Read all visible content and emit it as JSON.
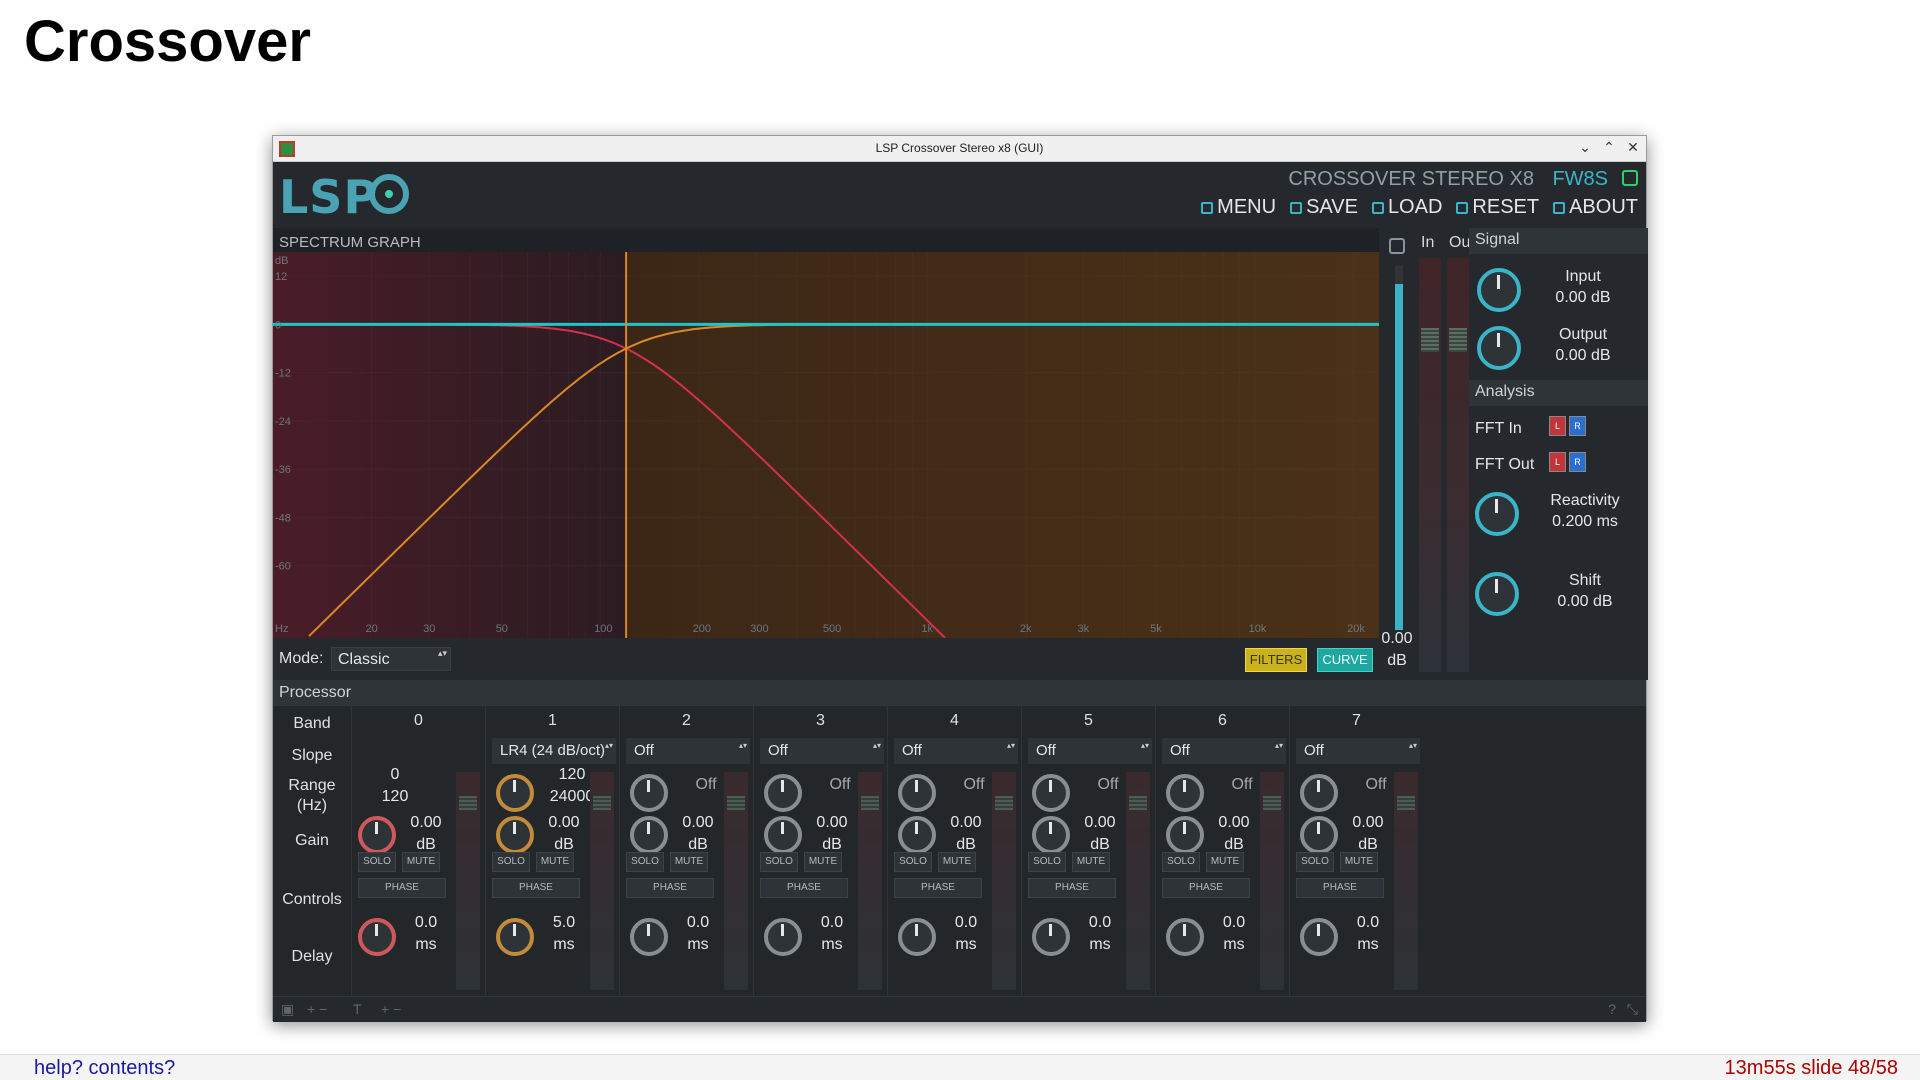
{
  "slide": {
    "title": "Crossover",
    "help": "help? contents?",
    "info": "13m55s slide 48/58"
  },
  "window": {
    "title": "LSP Crossover Stereo x8 (GUI)",
    "controls": [
      "⌄",
      "⌃",
      "✕"
    ]
  },
  "header": {
    "logo": "LSP",
    "plugin_name": "CROSSOVER STEREO X8",
    "format": "FW8S",
    "menu": [
      {
        "label": "MENU",
        "icon": "menu-icon"
      },
      {
        "label": "SAVE",
        "icon": "save-icon"
      },
      {
        "label": "LOAD",
        "icon": "load-icon"
      },
      {
        "label": "RESET",
        "icon": "reset-icon"
      },
      {
        "label": "ABOUT",
        "icon": "about-icon"
      }
    ]
  },
  "graph": {
    "label": "SPECTRUM GRAPH",
    "y_unit": "dB",
    "y_ticks": [
      "12",
      "0",
      "-12",
      "-24",
      "-36",
      "-48",
      "-60"
    ],
    "x_unit": "Hz",
    "x_ticks": [
      "20",
      "30",
      "50",
      "100",
      "200",
      "300",
      "500",
      "1k",
      "2k",
      "3k",
      "5k",
      "10k",
      "20k"
    ],
    "crossover_hz": 120,
    "colors": {
      "flat": "#22c3c8",
      "lowpass": "#d4304a",
      "highpass": "#d98a22"
    }
  },
  "mode": {
    "label": "Mode:",
    "value": "Classic",
    "filters": "FILTERS",
    "curve": "CURVE"
  },
  "meters": {
    "in": "In",
    "out": "Out",
    "zoom_value": "0.00",
    "zoom_unit": "dB",
    "zoom_level": 0.95
  },
  "signal": {
    "title": "Signal",
    "input_label": "Input",
    "input_value": "0.00 dB",
    "output_label": "Output",
    "output_value": "0.00 dB"
  },
  "analysis": {
    "title": "Analysis",
    "fft_in": "FFT In",
    "fft_out": "FFT Out",
    "l": "L",
    "r": "R",
    "reactivity_label": "Reactivity",
    "reactivity_value": "0.200 ms",
    "shift_label": "Shift",
    "shift_value": "0.00 dB"
  },
  "processor": {
    "title": "Processor",
    "row_labels": {
      "band": "Band",
      "slope": "Slope",
      "range": "Range",
      "range_unit": "(Hz)",
      "gain": "Gain",
      "controls": "Controls",
      "delay": "Delay"
    },
    "buttons": {
      "solo": "SOLO",
      "mute": "MUTE",
      "phase": "PHASE"
    },
    "bands": [
      {
        "num": "0",
        "slope": "",
        "range_lo": "0",
        "range_hi": "120",
        "gain": "0.00",
        "gain_unit": "dB",
        "delay": "0.0",
        "delay_unit": "ms"
      },
      {
        "num": "1",
        "slope": "LR4 (24 dB/oct)",
        "range_lo": "120",
        "range_hi": "24000",
        "gain": "0.00",
        "gain_unit": "dB",
        "delay": "5.0",
        "delay_unit": "ms"
      },
      {
        "num": "2",
        "slope": "Off",
        "range": "Off",
        "gain": "0.00",
        "gain_unit": "dB",
        "delay": "0.0",
        "delay_unit": "ms"
      },
      {
        "num": "3",
        "slope": "Off",
        "range": "Off",
        "gain": "0.00",
        "gain_unit": "dB",
        "delay": "0.0",
        "delay_unit": "ms"
      },
      {
        "num": "4",
        "slope": "Off",
        "range": "Off",
        "gain": "0.00",
        "gain_unit": "dB",
        "delay": "0.0",
        "delay_unit": "ms"
      },
      {
        "num": "5",
        "slope": "Off",
        "range": "Off",
        "gain": "0.00",
        "gain_unit": "dB",
        "delay": "0.0",
        "delay_unit": "ms"
      },
      {
        "num": "6",
        "slope": "Off",
        "range": "Off",
        "gain": "0.00",
        "gain_unit": "dB",
        "delay": "0.0",
        "delay_unit": "ms"
      },
      {
        "num": "7",
        "slope": "Off",
        "range": "Off",
        "gain": "0.00",
        "gain_unit": "dB",
        "delay": "0.0",
        "delay_unit": "ms"
      }
    ]
  }
}
